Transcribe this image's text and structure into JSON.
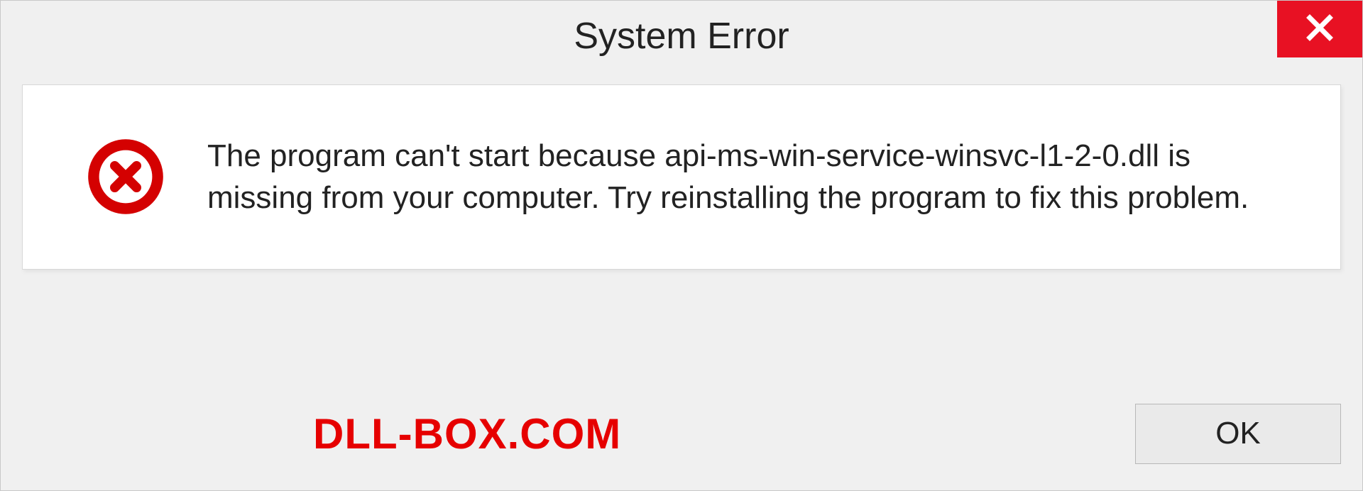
{
  "window": {
    "title": "System Error"
  },
  "message": {
    "text": "The program can't start because api-ms-win-service-winsvc-l1-2-0.dll is missing from your computer. Try reinstalling the program to fix this problem."
  },
  "buttons": {
    "ok_label": "OK"
  },
  "watermark": {
    "text": "DLL-BOX.COM"
  },
  "colors": {
    "close_bg": "#e81123",
    "error_red": "#d40101",
    "watermark_red": "#e60000"
  }
}
